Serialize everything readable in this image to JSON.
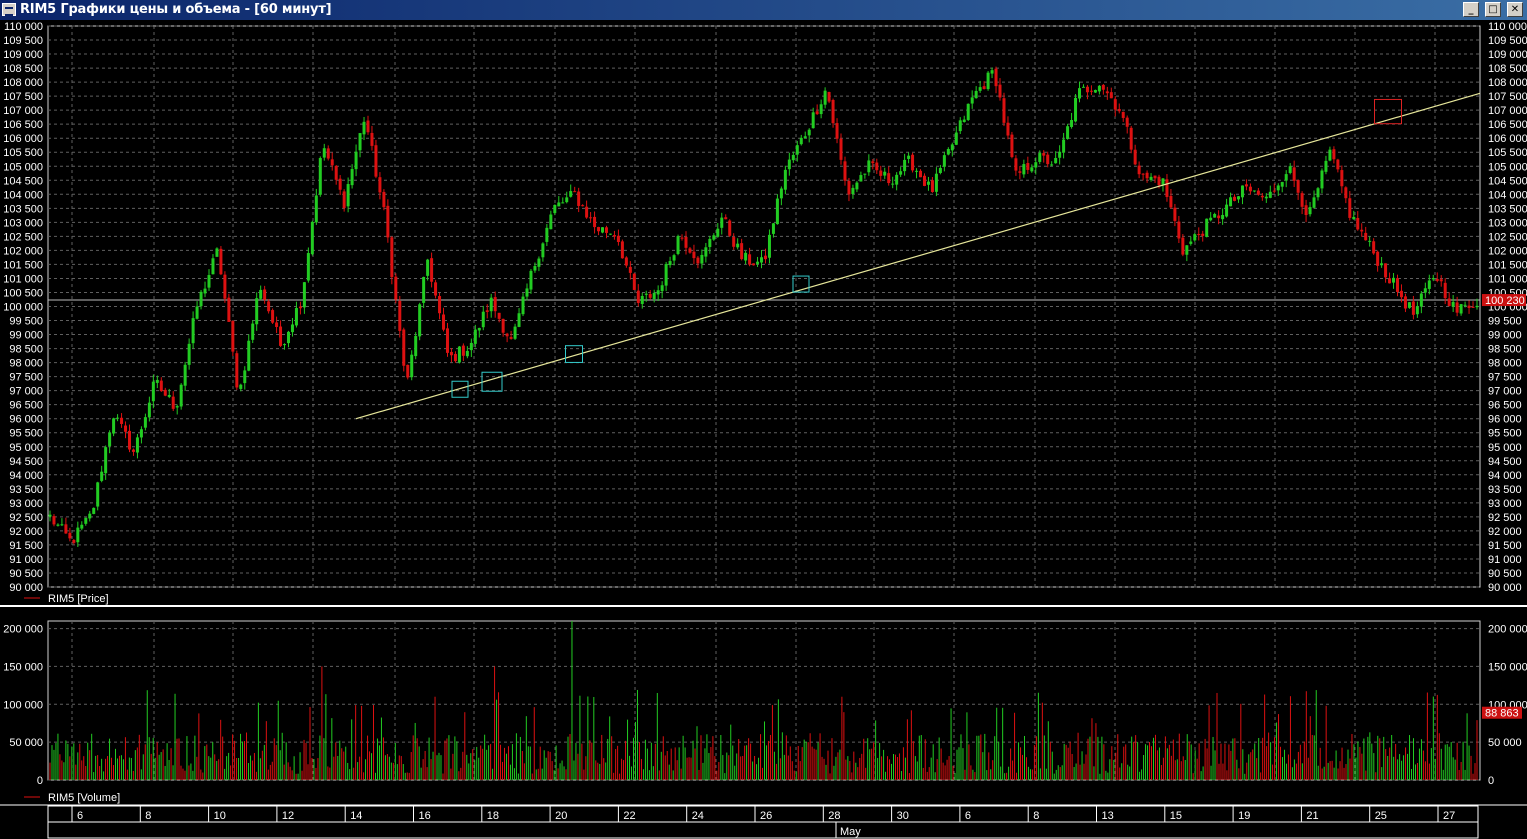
{
  "window": {
    "title": "RIM5 Графики цены и объема - [60 минут]",
    "minimize_icon": "_",
    "maximize_icon": "□",
    "close_icon": "✕"
  },
  "colors": {
    "background": "#000000",
    "up": "#22cc22",
    "down": "#dd1111",
    "grid": "#606060",
    "trendline": "#e6e69a",
    "marker": "#33cccc",
    "marker_red": "#dd2222",
    "last_price_tag": "#cc1111"
  },
  "chart_data": [
    {
      "type": "candlestick",
      "name": "RIM5 [Price]",
      "legend": "RIM5 [Price]",
      "ylim": [
        90000,
        110000
      ],
      "y_ticks": [
        90000,
        90500,
        91000,
        91500,
        92000,
        92500,
        93000,
        93500,
        94000,
        94500,
        95000,
        95500,
        96000,
        96500,
        97000,
        97500,
        98000,
        98500,
        99000,
        99500,
        100000,
        100500,
        101000,
        101500,
        102000,
        102500,
        103000,
        103500,
        104000,
        104500,
        105000,
        105500,
        106000,
        106500,
        107000,
        107500,
        108000,
        108500,
        109000,
        109500,
        110000
      ],
      "y_tick_labels": [
        "90 000",
        "90 500",
        "91 000",
        "91 500",
        "92 000",
        "92 500",
        "93 000",
        "93 500",
        "94 000",
        "94 500",
        "95 000",
        "95 500",
        "96 000",
        "96 500",
        "97 000",
        "97 500",
        "98 000",
        "98 500",
        "99 000",
        "99 500",
        "100 000",
        "100 500",
        "101 000",
        "101 500",
        "102 000",
        "102 500",
        "103 000",
        "103 500",
        "104 000",
        "104 500",
        "105 000",
        "105 500",
        "106 000",
        "106 500",
        "107 000",
        "107 500",
        "108 000",
        "108 500",
        "109 000",
        "109 500",
        "110 000"
      ],
      "last_price": 100230,
      "last_price_label": "100 230",
      "grid": true,
      "anchors": [
        92500,
        91600,
        92600,
        96200,
        94800,
        97300,
        96400,
        100000,
        102000,
        96800,
        100800,
        98600,
        100300,
        105800,
        103700,
        106800,
        103000,
        97100,
        101700,
        98100,
        98600,
        100200,
        98700,
        101300,
        103500,
        104000,
        102800,
        102600,
        100100,
        100600,
        102600,
        101600,
        103200,
        101700,
        101500,
        104800,
        106200,
        107800,
        104000,
        105000,
        104500,
        105200,
        104100,
        105800,
        107500,
        108400,
        104600,
        105300,
        105100,
        107600,
        108000,
        107000,
        104600,
        104500,
        102000,
        102800,
        103500,
        104200,
        103800,
        105000,
        103200,
        105500,
        103200,
        102000,
        100800,
        99700,
        101200,
        99800,
        100230
      ],
      "trendline": {
        "from": [
          96000
        ],
        "to": [
          107600
        ],
        "label": ""
      },
      "markers": [
        {
          "price": 97050,
          "color": "marker"
        },
        {
          "price": 97300,
          "color": "marker"
        },
        {
          "price": 98300,
          "color": "marker"
        },
        {
          "price": 100800,
          "color": "marker"
        },
        {
          "price": 106900,
          "color": "marker_red"
        }
      ]
    },
    {
      "type": "bar",
      "name": "RIM5 [Volume]",
      "legend": "RIM5 [Volume]",
      "ylim": [
        0,
        210000
      ],
      "y_ticks": [
        0,
        50000,
        100000,
        150000,
        200000
      ],
      "y_tick_labels": [
        "0",
        "50 000",
        "100 000",
        "150 000",
        "200 000"
      ],
      "last_volume": 88863,
      "last_volume_label": "88 863",
      "grid": true
    }
  ],
  "x_axis": {
    "day_labels": [
      "6",
      "8",
      "10",
      "12",
      "14",
      "16",
      "18",
      "20",
      "22",
      "24",
      "26",
      "28",
      "30",
      "6",
      "8",
      "13",
      "15",
      "19",
      "21",
      "25",
      "27"
    ],
    "month_label": "May"
  }
}
